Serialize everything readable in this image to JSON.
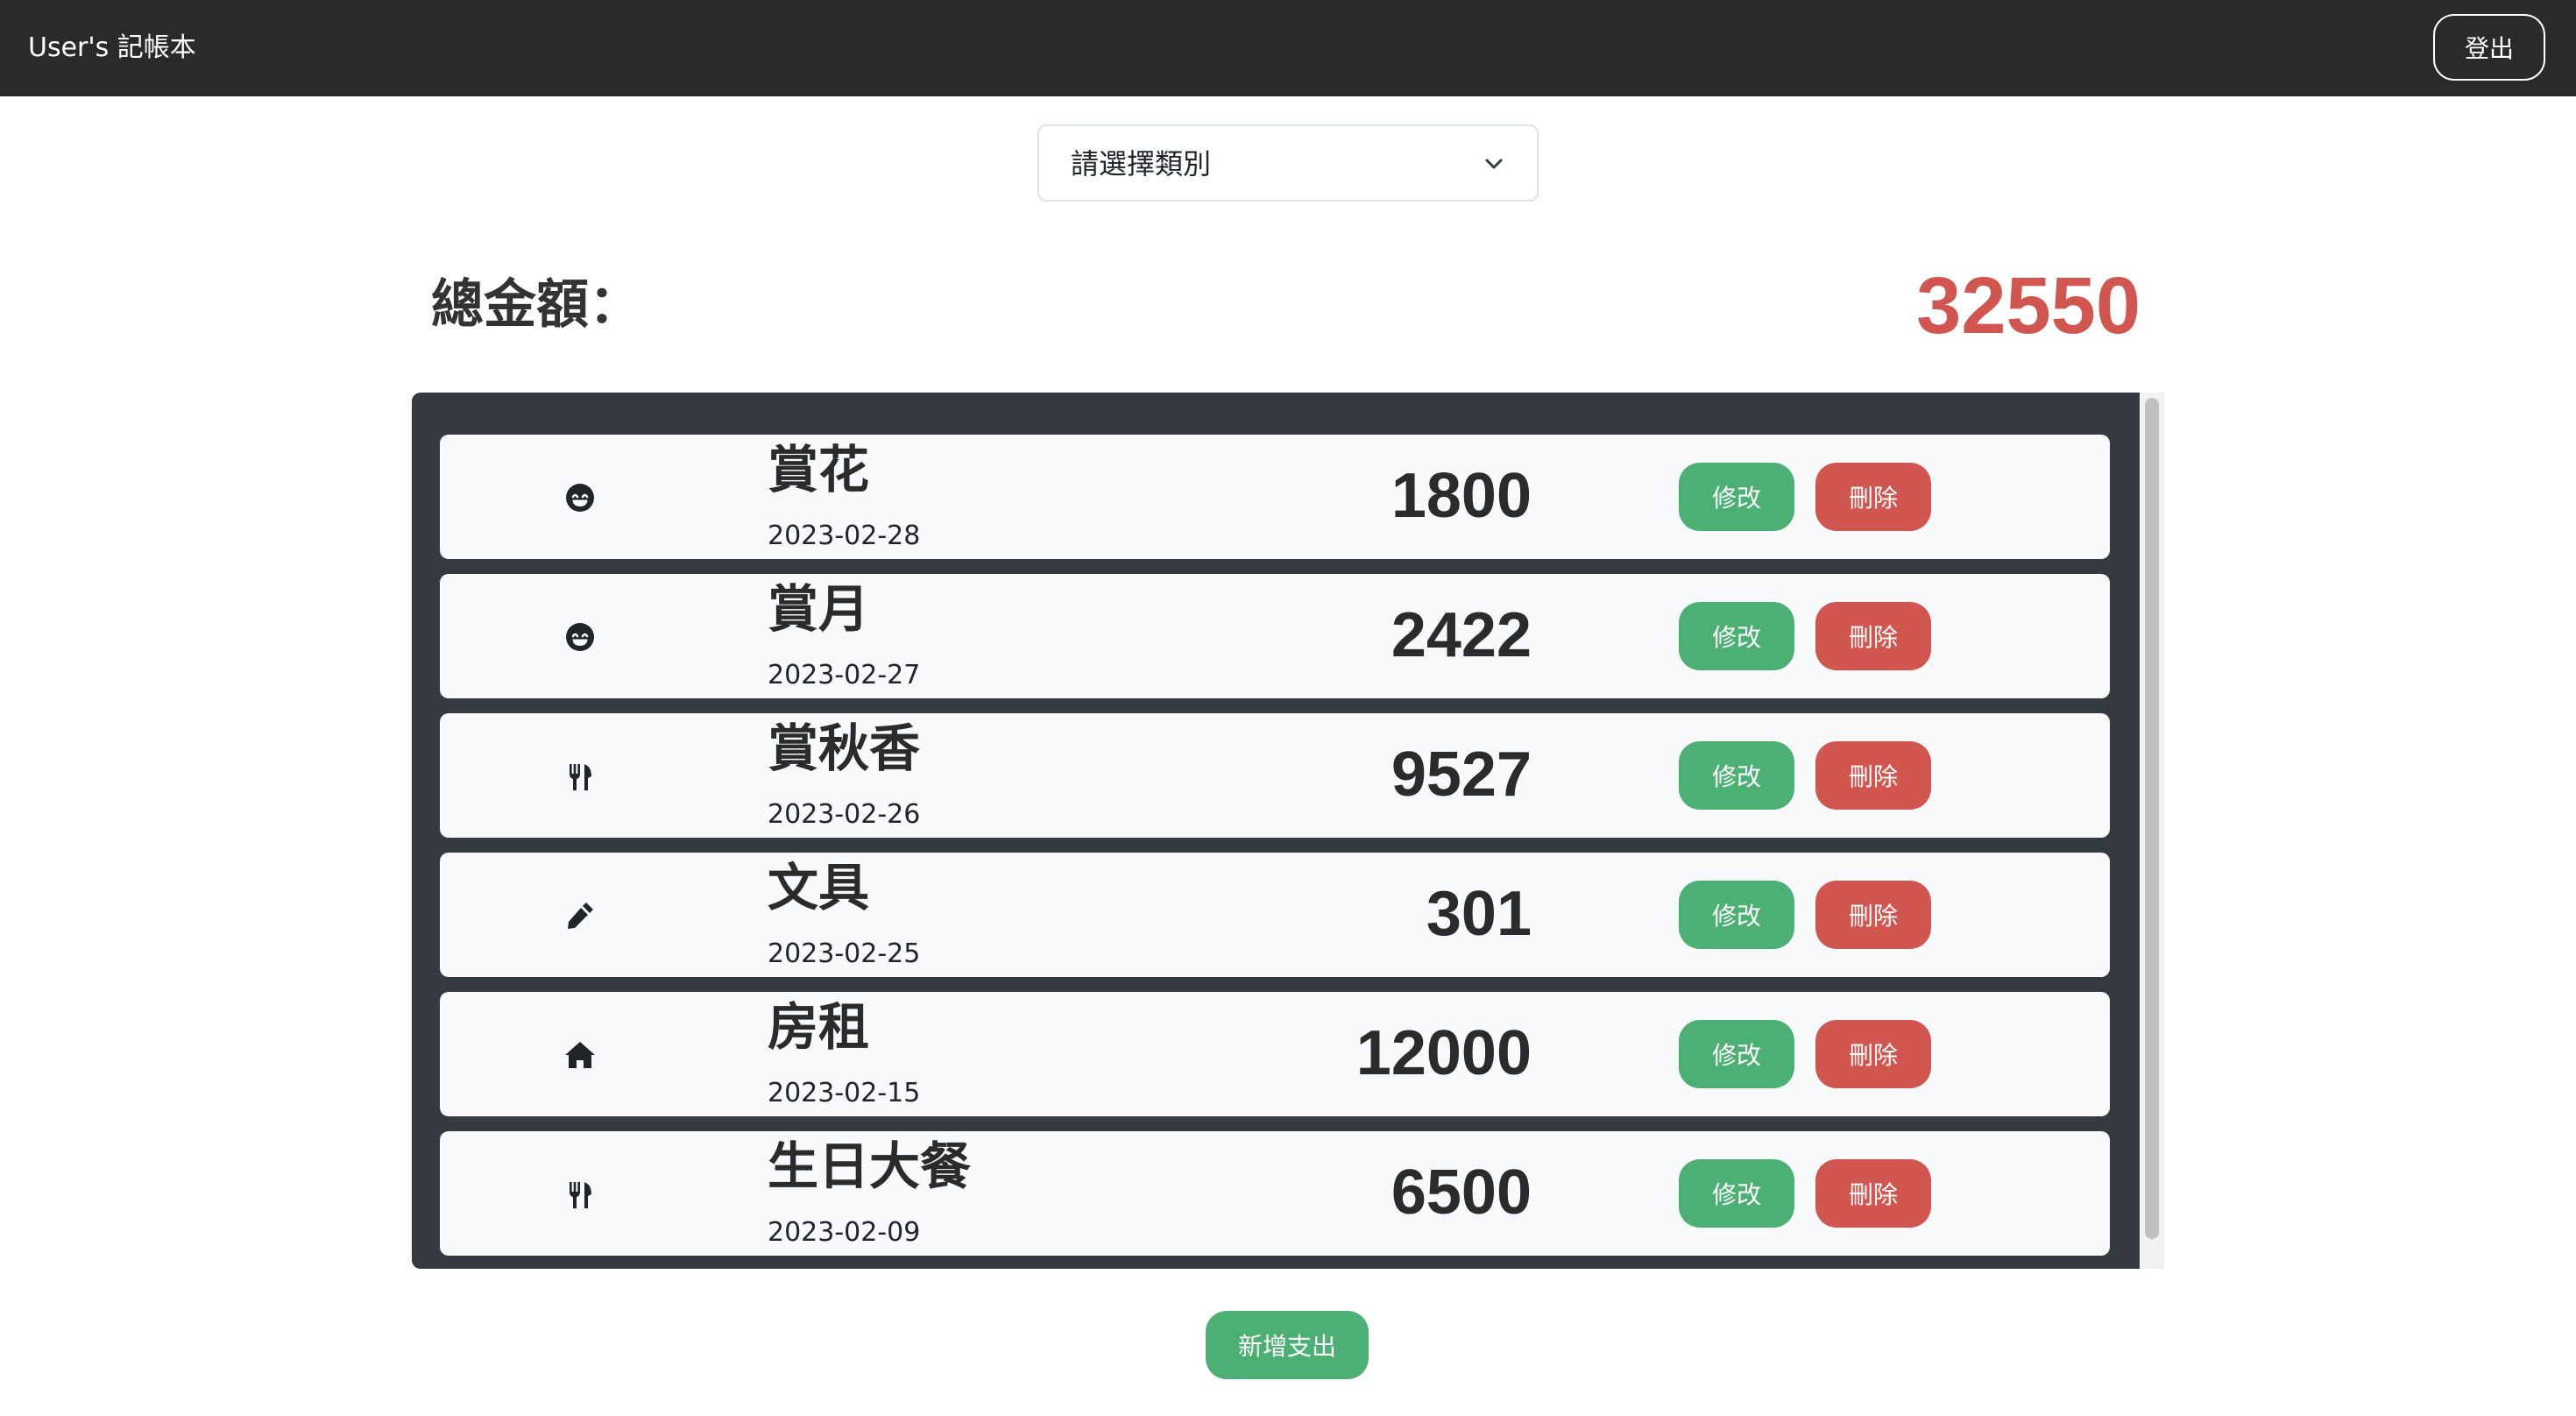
{
  "navbar": {
    "brand": "User's 記帳本",
    "logout_label": "登出"
  },
  "filter": {
    "selected": "請選擇類別",
    "icon": "chevron-down-icon"
  },
  "summary": {
    "label": "總金額：",
    "total": "32550",
    "total_color": "#d0564f"
  },
  "expenses": [
    {
      "icon": "smile-icon",
      "title": "賞花",
      "date": "2023-02-28",
      "amount": "1800",
      "edit_label": "修改",
      "delete_label": "刪除"
    },
    {
      "icon": "smile-icon",
      "title": "賞月",
      "date": "2023-02-27",
      "amount": "2422",
      "edit_label": "修改",
      "delete_label": "刪除"
    },
    {
      "icon": "utensils-icon",
      "title": "賞秋香",
      "date": "2023-02-26",
      "amount": "9527",
      "edit_label": "修改",
      "delete_label": "刪除"
    },
    {
      "icon": "pencil-icon",
      "title": "文具",
      "date": "2023-02-25",
      "amount": "301",
      "edit_label": "修改",
      "delete_label": "刪除"
    },
    {
      "icon": "home-icon",
      "title": "房租",
      "date": "2023-02-15",
      "amount": "12000",
      "edit_label": "修改",
      "delete_label": "刪除"
    },
    {
      "icon": "utensils-icon",
      "title": "生日大餐",
      "date": "2023-02-09",
      "amount": "6500",
      "edit_label": "修改",
      "delete_label": "刪除"
    }
  ],
  "add_button_label": "新增支出",
  "colors": {
    "navbar": "#2a2a2b",
    "panel": "#343a40",
    "row": "#f8f9fa",
    "edit": "#4caf73",
    "delete": "#d0564f"
  }
}
